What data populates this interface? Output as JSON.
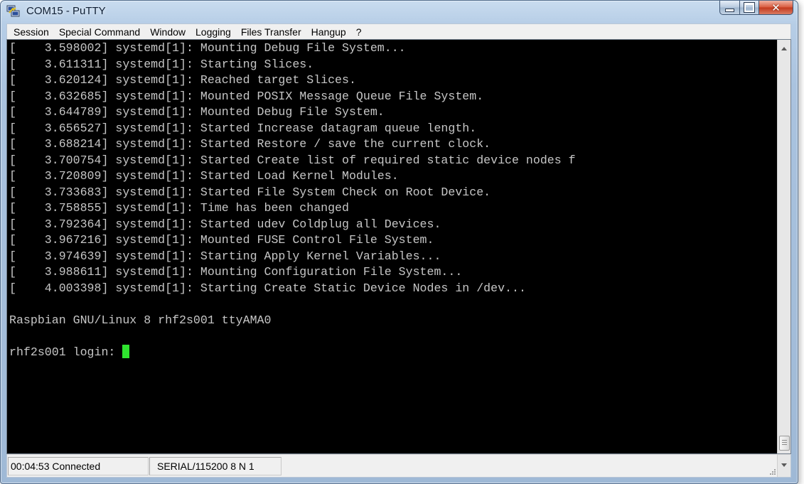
{
  "window": {
    "title": "COM15 - PuTTY",
    "icon": "putty-icon"
  },
  "menu": {
    "items": [
      "Session",
      "Special Command",
      "Window",
      "Logging",
      "Files Transfer",
      "Hangup",
      "?"
    ]
  },
  "terminal": {
    "lines": [
      "[    3.598002] systemd[1]: Mounting Debug File System...",
      "[    3.611311] systemd[1]: Starting Slices.",
      "[    3.620124] systemd[1]: Reached target Slices.",
      "[    3.632685] systemd[1]: Mounted POSIX Message Queue File System.",
      "[    3.644789] systemd[1]: Mounted Debug File System.",
      "[    3.656527] systemd[1]: Started Increase datagram queue length.",
      "[    3.688214] systemd[1]: Started Restore / save the current clock.",
      "[    3.700754] systemd[1]: Started Create list of required static device nodes f",
      "[    3.720809] systemd[1]: Started Load Kernel Modules.",
      "[    3.733683] systemd[1]: Started File System Check on Root Device.",
      "[    3.758855] systemd[1]: Time has been changed",
      "[    3.792364] systemd[1]: Started udev Coldplug all Devices.",
      "[    3.967216] systemd[1]: Mounted FUSE Control File System.",
      "[    3.974639] systemd[1]: Starting Apply Kernel Variables...",
      "[    3.988611] systemd[1]: Mounting Configuration File System...",
      "[    4.003398] systemd[1]: Starting Create Static Device Nodes in /dev...",
      "",
      "Raspbian GNU/Linux 8 rhf2s001 ttyAMA0",
      ""
    ],
    "prompt": "rhf2s001 login: ",
    "cursor_color": "#2fe42f",
    "text_color": "#c6c6c6",
    "background": "#000000"
  },
  "status": {
    "connection": "00:04:53 Connected",
    "serial": "SERIAL/115200 8 N 1"
  }
}
